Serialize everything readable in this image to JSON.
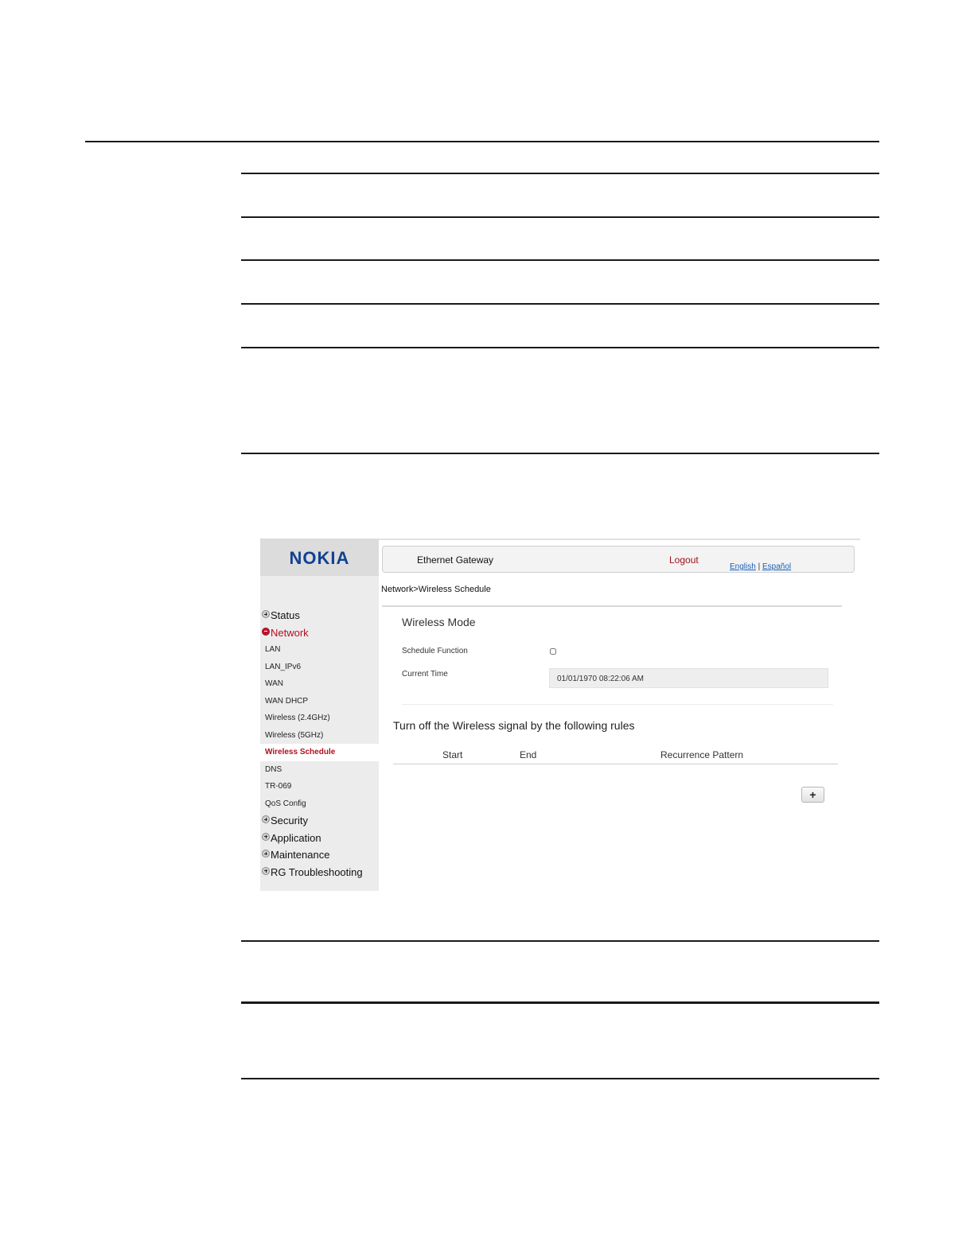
{
  "logo": "NOKIA",
  "header": {
    "title": "Ethernet Gateway",
    "logout": "Logout",
    "lang_english": "English",
    "lang_separator": "|",
    "lang_spanish": "Español"
  },
  "breadcrumb": "Network>Wireless Schedule",
  "nav": {
    "status": "Status",
    "network": "Network",
    "network_items": [
      "LAN",
      "LAN_IPv6",
      "WAN",
      "WAN DHCP",
      "Wireless (2.4GHz)",
      "Wireless (5GHz)",
      "Wireless Schedule",
      "DNS",
      "TR-069",
      "QoS Config"
    ],
    "security": "Security",
    "application": "Application",
    "maintenance": "Maintenance",
    "troubleshooting": "RG Troubleshooting"
  },
  "main": {
    "section_title": "Wireless Mode",
    "schedule_function_label": "Schedule Function",
    "schedule_function_checked": false,
    "current_time_label": "Current Time",
    "current_time_value": "01/01/1970 08:22:06 AM",
    "rules_title": "Turn off the Wireless signal by the following rules",
    "columns": [
      "Start",
      "End",
      "Recurrence Pattern"
    ],
    "add_button": "+"
  },
  "colors": {
    "brand": "#124191",
    "active_red": "#b01020",
    "logout_red": "#a0101e",
    "link_blue": "#1a5fb4"
  }
}
